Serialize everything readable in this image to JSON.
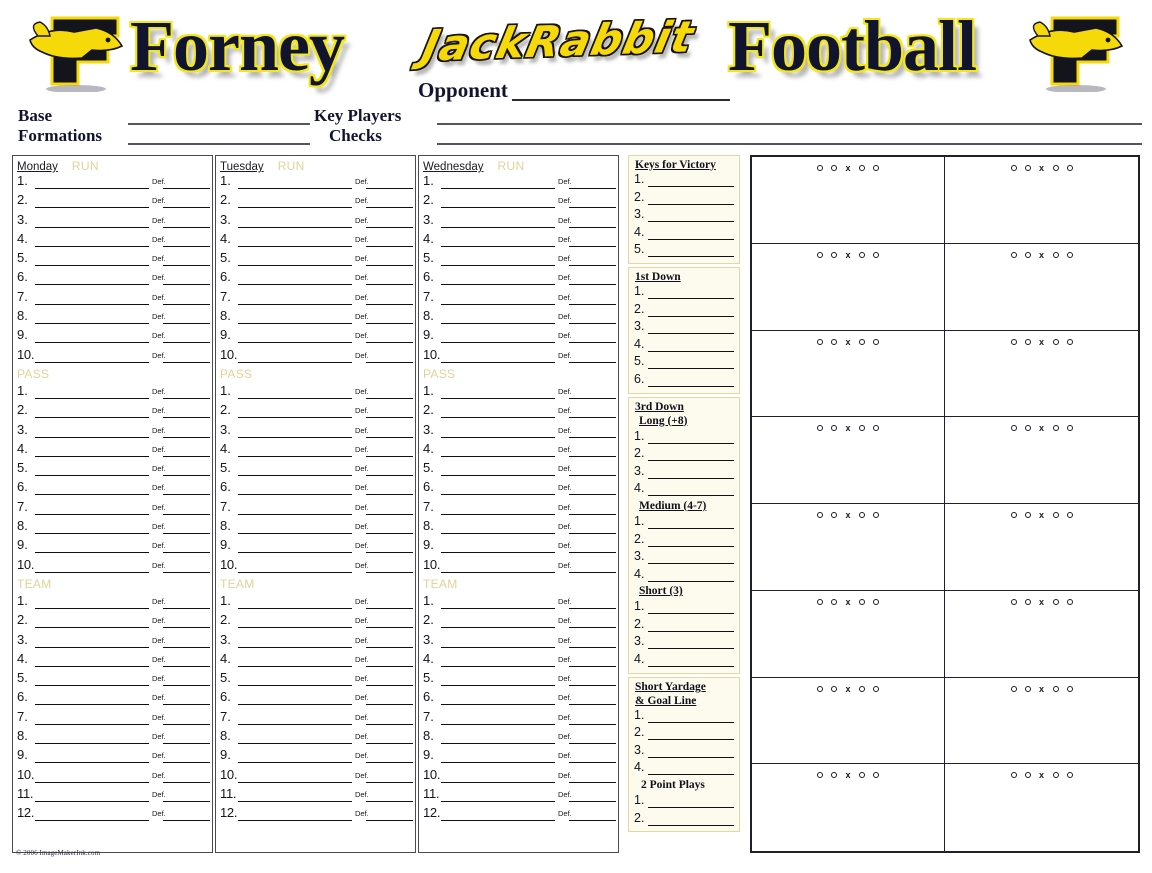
{
  "header": {
    "team_name": "Forney",
    "mascot": "JackRabbit",
    "sport": "Football",
    "opponent_label": "Opponent",
    "base_label": "Base",
    "formations_label": "Formations",
    "key_players_label": "Key Players",
    "checks_label": "Checks",
    "logo_letter": "F",
    "accent_yellow": "#f2e71d",
    "title_navy": "#11142e",
    "mascot_yellow": "#f5d908"
  },
  "practice_columns": [
    {
      "day": "Monday",
      "sections": [
        {
          "label": "RUN",
          "rows": 10,
          "def_label": "Def."
        },
        {
          "label": "PASS",
          "rows": 10,
          "def_label": "Def."
        },
        {
          "label": "TEAM",
          "rows": 12,
          "def_label": "Def."
        }
      ]
    },
    {
      "day": "Tuesday",
      "sections": [
        {
          "label": "RUN",
          "rows": 10,
          "def_label": "Def."
        },
        {
          "label": "PASS",
          "rows": 10,
          "def_label": "Def."
        },
        {
          "label": "TEAM",
          "rows": 12,
          "def_label": "Def."
        }
      ]
    },
    {
      "day": "Wednesday",
      "sections": [
        {
          "label": "RUN",
          "rows": 10,
          "def_label": "Def."
        },
        {
          "label": "PASS",
          "rows": 10,
          "def_label": "Def."
        },
        {
          "label": "TEAM",
          "rows": 12,
          "def_label": "Def."
        }
      ]
    }
  ],
  "situation_boxes": [
    {
      "title": "Keys for Victory",
      "subsections": [
        {
          "subtitle": "",
          "rows": 5
        }
      ]
    },
    {
      "title": "1st Down",
      "subsections": [
        {
          "subtitle": "",
          "rows": 6
        }
      ]
    },
    {
      "title": "3rd Down",
      "subsections": [
        {
          "subtitle": "Long (+8)",
          "rows": 4
        },
        {
          "subtitle": "Medium (4-7)",
          "rows": 4
        },
        {
          "subtitle": "Short (3)",
          "rows": 4
        }
      ]
    },
    {
      "title": "Short Yardage",
      "title_line2": "& Goal Line",
      "subsections": [
        {
          "subtitle": "",
          "rows": 4
        },
        {
          "subtitle": "2 Point Plays",
          "rows": 2
        }
      ]
    }
  ],
  "play_grid": {
    "columns": 2,
    "rows": 8,
    "formation_marks": [
      "o",
      "o",
      "x",
      "o",
      "o"
    ]
  },
  "footer": {
    "copyright": "© 2006 ImageMakerInk.com"
  }
}
